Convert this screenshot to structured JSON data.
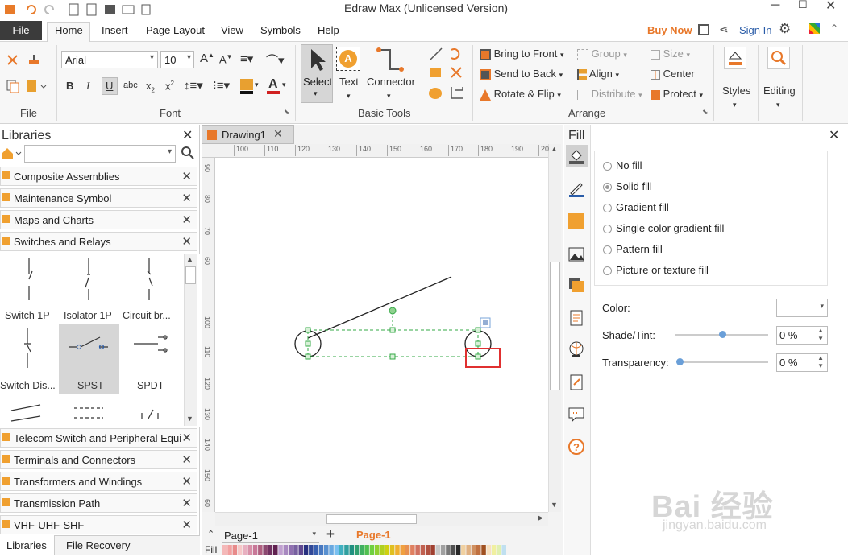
{
  "window": {
    "title": "Edraw Max (Unlicensed Version)"
  },
  "menu": {
    "file": "File",
    "tabs": [
      "Home",
      "Insert",
      "Page Layout",
      "View",
      "Symbols",
      "Help"
    ],
    "buy_now": "Buy Now",
    "sign_in": "Sign In"
  },
  "font": {
    "name": "Arial",
    "size": "10",
    "group_label": "Font"
  },
  "file_group": {
    "label": "File"
  },
  "basic_tools": {
    "label": "Basic Tools",
    "select": "Select",
    "text": "Text",
    "connector": "Connector"
  },
  "arrange": {
    "label": "Arrange",
    "bring_front": "Bring to Front",
    "send_back": "Send to Back",
    "rotate_flip": "Rotate & Flip",
    "group": "Group",
    "align": "Align",
    "distribute": "Distribute",
    "size": "Size",
    "center": "Center",
    "protect": "Protect"
  },
  "styles": {
    "label": "Styles"
  },
  "editing": {
    "label": "Editing"
  },
  "libraries": {
    "title": "Libraries",
    "top_items": [
      "Composite Assemblies",
      "Maintenance Symbol",
      "Maps and Charts",
      "Switches and Relays"
    ],
    "shapes": [
      "Switch 1P",
      "Isolator 1P",
      "Circuit br...",
      "Switch Dis...",
      "SPST",
      "SPDT"
    ],
    "bottom_items": [
      "Telecom Switch and Peripheral Equip",
      "Terminals and Connectors",
      "Transformers and Windings",
      "Transmission Path",
      "VHF-UHF-SHF"
    ],
    "tabs": [
      "Libraries",
      "File Recovery"
    ]
  },
  "document": {
    "tab": "Drawing1",
    "page_selector": "Page-1",
    "page_tab": "Page-1",
    "fill_label": "Fill"
  },
  "ruler": {
    "h": [
      "100",
      "110",
      "120",
      "130",
      "140",
      "150",
      "160",
      "170",
      "180",
      "190",
      "20"
    ],
    "v": [
      "90",
      "80",
      "70",
      "60",
      "100",
      "110",
      "120",
      "130",
      "140",
      "150",
      "60"
    ]
  },
  "fill_panel": {
    "title": "Fill",
    "options": [
      "No fill",
      "Solid fill",
      "Gradient fill",
      "Single color gradient fill",
      "Pattern fill",
      "Picture or texture fill"
    ],
    "selected": "Solid fill",
    "color_label": "Color:",
    "shade_label": "Shade/Tint:",
    "shade_value": "0 %",
    "transparency_label": "Transparency:",
    "transparency_value": "0 %"
  },
  "watermark": {
    "text": "Bai 经验",
    "url": "jingyan.baidu.com"
  },
  "colors": {
    "accent": "#e8782a",
    "tab_active": "#3b3b3b",
    "highlight_red": "#e03030",
    "selection_green": "#33a845"
  }
}
